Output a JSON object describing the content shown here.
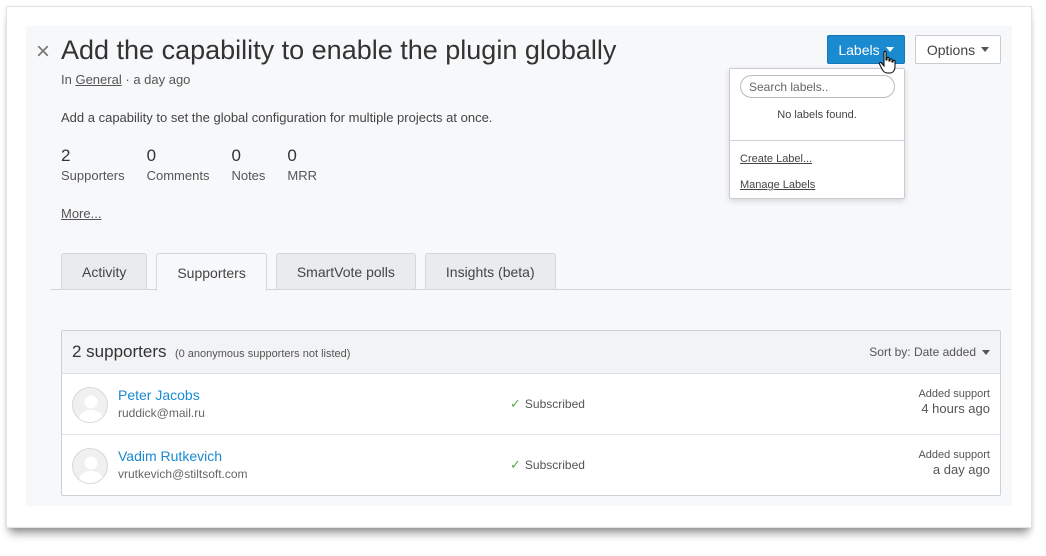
{
  "header": {
    "title": "Add the capability to enable the plugin globally",
    "close_glyph": "×",
    "meta_prefix": "In",
    "category": "General",
    "meta_sep": "·",
    "time_ago": "a day ago"
  },
  "description": "Add a capability to set the global configuration for multiple projects at once.",
  "stats": [
    {
      "value": "2",
      "label": "Supporters"
    },
    {
      "value": "0",
      "label": "Comments"
    },
    {
      "value": "0",
      "label": "Notes"
    },
    {
      "value": "0",
      "label": "MRR"
    }
  ],
  "more_link": "More...",
  "tabs": [
    {
      "label": "Activity",
      "active": false
    },
    {
      "label": "Supporters",
      "active": true
    },
    {
      "label": "SmartVote polls",
      "active": false
    },
    {
      "label": "Insights (beta)",
      "active": false
    }
  ],
  "supporters": {
    "title": "2 supporters",
    "subtitle": "(0 anonymous supporters not listed)",
    "sort_label": "Sort by: Date added",
    "rows": [
      {
        "name": "Peter Jacobs",
        "email": "ruddick@mail.ru",
        "status": "Subscribed",
        "added_label": "Added support",
        "added_time": "4 hours ago"
      },
      {
        "name": "Vadim Rutkevich",
        "email": "vrutkevich@stiltsoft.com",
        "status": "Subscribed",
        "added_label": "Added support",
        "added_time": "a day ago"
      }
    ]
  },
  "toolbar": {
    "labels_button": "Labels",
    "options_button": "Options"
  },
  "labels_dropdown": {
    "search_placeholder": "Search labels..",
    "empty_text": "No labels found.",
    "create_link": "Create Label...",
    "manage_link": "Manage Labels"
  },
  "colors": {
    "accent": "#1a8ad1",
    "check": "#5aa84a"
  }
}
